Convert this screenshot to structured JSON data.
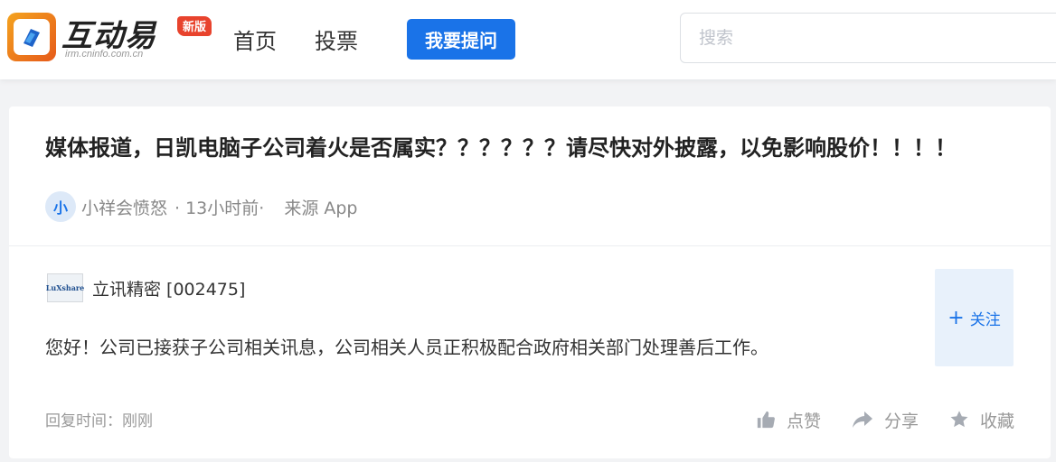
{
  "header": {
    "logo": {
      "name": "互动易",
      "url_text": "irm.cninfo.com.cn",
      "badge": "新版"
    },
    "nav": [
      {
        "label": "首页"
      },
      {
        "label": "投票"
      }
    ],
    "ask_button": "我要提问",
    "search": {
      "placeholder": "搜索",
      "value": ""
    }
  },
  "question": {
    "title": "媒体报道，日凯电脑子公司着火是否属实？？？？？？请尽快对外披露，以免影响股价！！！！",
    "asker": {
      "avatar_char": "小",
      "name": "小祥会愤怒",
      "time": "· 13小时前·",
      "source": "来源 App"
    }
  },
  "answer": {
    "company": {
      "logo_text": "LuXshare",
      "name": "立讯精密 [002475]"
    },
    "text": "您好！公司已接获子公司相关讯息，公司相关人员正积极配合政府相关部门处理善后工作。",
    "follow_label": "关注",
    "reply_time": "回复时间：刚刚",
    "actions": [
      {
        "icon": "thumbs-up-icon",
        "label": "点赞"
      },
      {
        "icon": "share-icon",
        "label": "分享"
      },
      {
        "icon": "star-icon",
        "label": "收藏"
      }
    ]
  },
  "colors": {
    "brand_blue": "#1a73e8",
    "badge_red": "#e8432d",
    "muted_text": "#999999"
  }
}
